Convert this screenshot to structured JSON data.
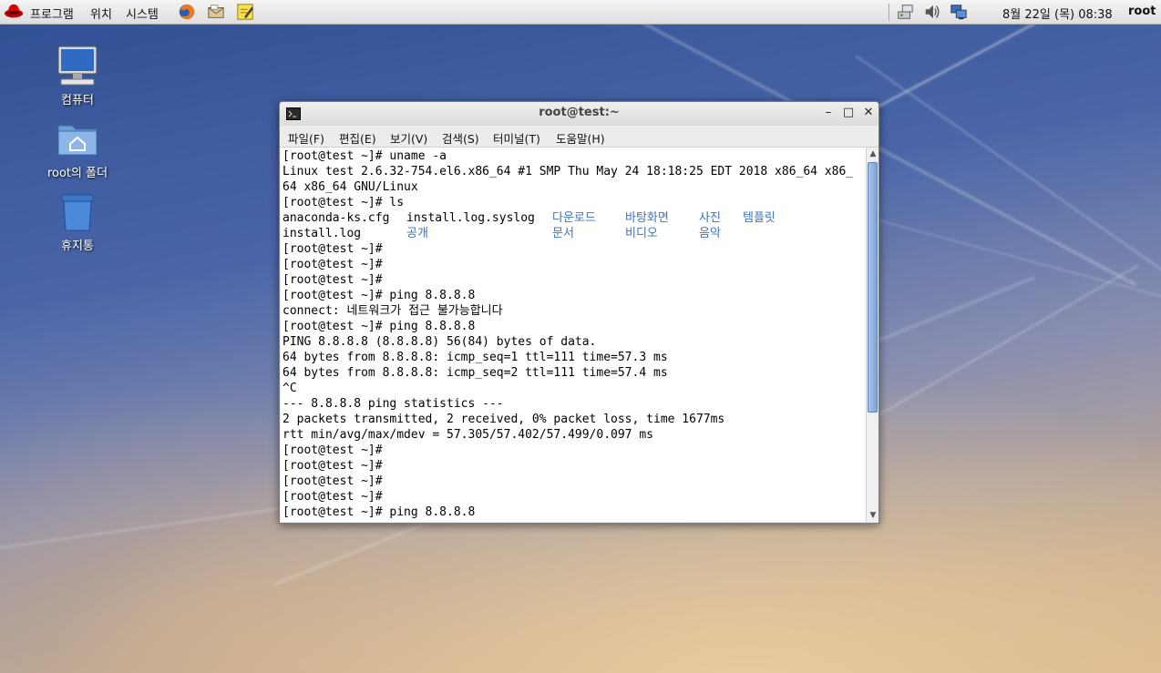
{
  "panel": {
    "menus": [
      "프로그램",
      "위치",
      "시스템"
    ],
    "clock": "8월 22일 (목) 08:38",
    "user": "root",
    "launcher_icons": [
      "firefox-icon",
      "mail-icon",
      "notes-icon"
    ],
    "tray_icons": [
      "network-icon",
      "volume-icon",
      "display-icon"
    ]
  },
  "desktop": {
    "icons": [
      {
        "label": "컴퓨터",
        "icon": "computer-icon"
      },
      {
        "label": "root의 폴더",
        "icon": "home-folder-icon"
      },
      {
        "label": "휴지통",
        "icon": "trash-icon"
      }
    ]
  },
  "terminal": {
    "title": "root@test:~",
    "menu": [
      "파일(F)",
      "편집(E)",
      "보기(V)",
      "검색(S)",
      "터미널(T)",
      "도움말(H)"
    ],
    "lines": [
      "[root@test ~]# uname -a",
      "Linux test 2.6.32-754.el6.x86_64 #1 SMP Thu May 24 18:18:25 EDT 2018 x86_64 x86_",
      "64 x86_64 GNU/Linux",
      "[root@test ~]# ls",
      "",
      "",
      "[root@test ~]#",
      "[root@test ~]#",
      "[root@test ~]#",
      "[root@test ~]# ping 8.8.8.8",
      "connect: 네트워크가 접근 불가능합니다",
      "[root@test ~]# ping 8.8.8.8",
      "PING 8.8.8.8 (8.8.8.8) 56(84) bytes of data.",
      "64 bytes from 8.8.8.8: icmp_seq=1 ttl=111 time=57.3 ms",
      "64 bytes from 8.8.8.8: icmp_seq=2 ttl=111 time=57.4 ms",
      "^C",
      "--- 8.8.8.8 ping statistics ---",
      "2 packets transmitted, 2 received, 0% packet loss, time 1677ms",
      "rtt min/avg/max/mdev = 57.305/57.402/57.499/0.097 ms",
      "[root@test ~]#",
      "[root@test ~]#",
      "[root@test ~]#",
      "[root@test ~]#",
      "[root@test ~]# ping 8.8.8.8"
    ],
    "ls_output": {
      "row1": {
        "files": [
          "anaconda-ks.cfg",
          "install.log.syslog"
        ],
        "dirs": [
          "다운로드",
          "바탕화면",
          "사진",
          "템플릿"
        ]
      },
      "row2": {
        "files": [
          "install.log"
        ],
        "dirs": [
          "공개",
          "문서",
          "비디오",
          "음악"
        ]
      }
    }
  }
}
